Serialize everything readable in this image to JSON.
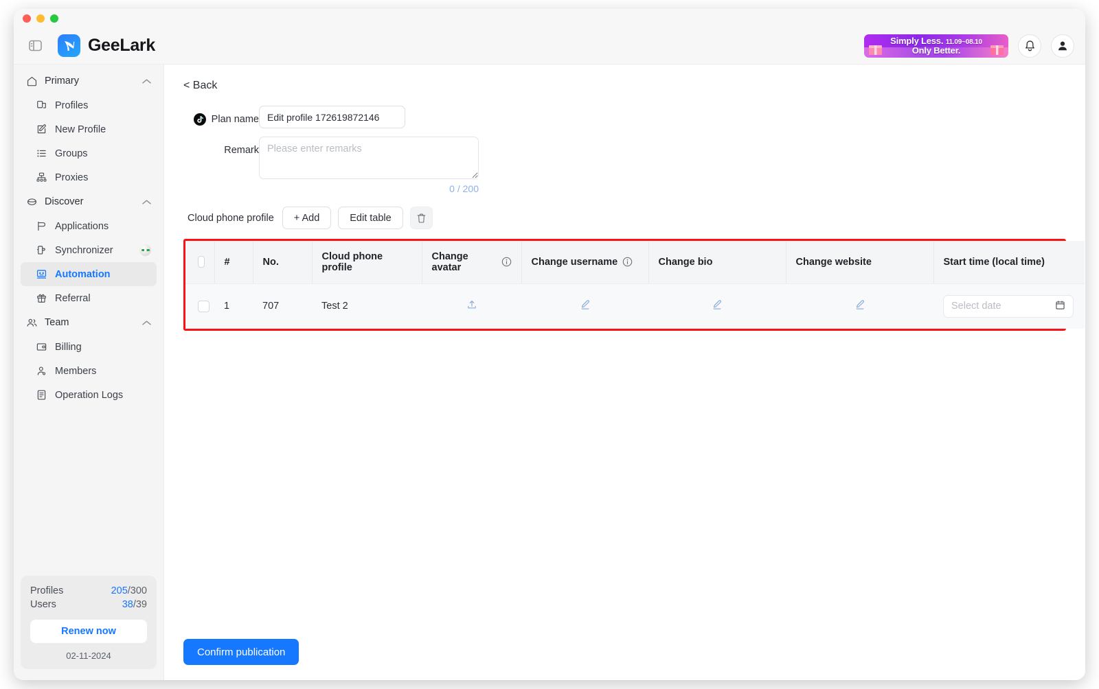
{
  "window": {
    "traffic_lights": [
      "close",
      "minimize",
      "maximize"
    ]
  },
  "header": {
    "brand_name": "GeeLark",
    "panel_toggle_icon": "sidebar-toggle-icon",
    "promo": {
      "line1": "Simply Less.",
      "line2": "Only Better.",
      "dates": "11.09~08.10"
    },
    "notifications_icon": "bell-icon",
    "account_icon": "user-icon"
  },
  "sidebar": {
    "groups": [
      {
        "label": "Primary",
        "icon": "home-icon",
        "expanded": true,
        "items": [
          {
            "label": "Profiles",
            "icon": "profiles-icon",
            "active": false
          },
          {
            "label": "New Profile",
            "icon": "new-profile-icon",
            "active": false
          },
          {
            "label": "Groups",
            "icon": "groups-list-icon",
            "active": false
          },
          {
            "label": "Proxies",
            "icon": "proxies-network-icon",
            "active": false
          }
        ]
      },
      {
        "label": "Discover",
        "icon": "cloud-icon",
        "expanded": true,
        "items": [
          {
            "label": "Applications",
            "icon": "applications-icon",
            "active": false
          },
          {
            "label": "Synchronizer",
            "icon": "synchronizer-icon",
            "active": false,
            "badge": "sync-status-badge"
          },
          {
            "label": "Automation",
            "icon": "automation-icon",
            "active": true
          },
          {
            "label": "Referral",
            "icon": "gift-icon",
            "active": false
          }
        ]
      },
      {
        "label": "Team",
        "icon": "team-icon",
        "expanded": true,
        "items": [
          {
            "label": "Billing",
            "icon": "billing-card-icon",
            "active": false
          },
          {
            "label": "Members",
            "icon": "members-icon",
            "active": false
          },
          {
            "label": "Operation Logs",
            "icon": "logs-icon",
            "active": false
          }
        ]
      }
    ],
    "plan": {
      "profiles_label": "Profiles",
      "profiles_used": "205",
      "profiles_total": "/300",
      "users_label": "Users",
      "users_used": "38",
      "users_total": "/39",
      "renew_label": "Renew now",
      "expiry_date": "02-11-2024"
    }
  },
  "main": {
    "back_label": "< Back",
    "form": {
      "plan_name_label": "Plan name",
      "plan_name_icon": "tiktok-icon",
      "plan_name_value": "Edit profile 172619872146",
      "remark_label": "Remark",
      "remark_value": "",
      "remark_placeholder": "Please enter remarks",
      "remark_counter": "0 / 200"
    },
    "toolbar": {
      "label": "Cloud phone profile",
      "add_label": "+  Add",
      "edit_table_label": "Edit table",
      "delete_icon": "trash-icon"
    },
    "table": {
      "highlight_color": "#fb1212",
      "columns": [
        {
          "key": "checkbox",
          "label": "",
          "icon": "select-all-checkbox"
        },
        {
          "key": "index",
          "label": "#"
        },
        {
          "key": "no",
          "label": "No."
        },
        {
          "key": "cloud_phone_profile",
          "label": "Cloud phone profile"
        },
        {
          "key": "change_avatar",
          "label": "Change avatar",
          "info": true
        },
        {
          "key": "change_username",
          "label": "Change username",
          "info": true
        },
        {
          "key": "change_bio",
          "label": "Change bio"
        },
        {
          "key": "change_website",
          "label": "Change website"
        },
        {
          "key": "start_time",
          "label": "Start time (local time)"
        }
      ],
      "rows": [
        {
          "index": "1",
          "no": "707",
          "cloud_phone_profile": "Test 2",
          "change_avatar_icon": "upload-icon",
          "change_username_icon": "edit-pencil-icon",
          "change_bio_icon": "edit-pencil-icon",
          "change_website_icon": "edit-pencil-icon",
          "start_time_placeholder": "Select date",
          "start_time_icon": "calendar-icon"
        }
      ]
    },
    "confirm_label": "Confirm publication"
  }
}
